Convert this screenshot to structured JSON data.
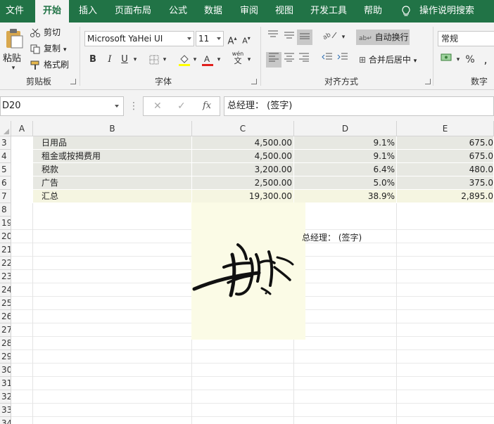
{
  "menu": {
    "tabs": [
      "文件",
      "开始",
      "插入",
      "页面布局",
      "公式",
      "数据",
      "审阅",
      "视图",
      "开发工具",
      "帮助"
    ],
    "tell_me": "操作说明搜索"
  },
  "ribbon": {
    "clipboard": {
      "paste": "粘贴",
      "cut": "剪切",
      "copy": "复制",
      "format_painter": "格式刷",
      "group": "剪贴板"
    },
    "font": {
      "name": "Microsoft YaHei UI",
      "size": "11",
      "bold": "B",
      "italic": "I",
      "underline": "U",
      "grow": "A",
      "shrink": "A",
      "phonetic_top": "wén",
      "phonetic_bottom": "文",
      "group": "字体"
    },
    "alignment": {
      "wrap_text": "自动换行",
      "merge_center": "合并后居中",
      "group": "对齐方式"
    },
    "number": {
      "format": "常规",
      "percent": "%",
      "comma": ",",
      "group": "数字"
    }
  },
  "formula_bar": {
    "name_box": "D20",
    "fx": "fx",
    "content": "总经理：  (签字)"
  },
  "grid": {
    "columns": [
      "A",
      "B",
      "C",
      "D",
      "E"
    ],
    "row_numbers": [
      "3",
      "4",
      "5",
      "6",
      "7",
      "8",
      "19",
      "20",
      "21",
      "22",
      "23",
      "24",
      "25",
      "26",
      "27",
      "28",
      "29",
      "30",
      "31",
      "32",
      "33",
      "34"
    ],
    "rows": [
      {
        "b": "日用品",
        "c": "4,500.00",
        "d": "9.1%",
        "e": "675.0"
      },
      {
        "b": "租金或按揭费用",
        "c": "4,500.00",
        "d": "9.1%",
        "e": "675.0"
      },
      {
        "b": "税款",
        "c": "3,200.00",
        "d": "6.4%",
        "e": "480.0"
      },
      {
        "b": "广告",
        "c": "2,500.00",
        "d": "5.0%",
        "e": "375.0"
      },
      {
        "b": "汇总",
        "c": "19,300.00",
        "d": "38.9%",
        "e": "2,895.0"
      }
    ],
    "manager_sign": "总经理：  (签字)"
  },
  "colors": {
    "accent": "#217346",
    "data_row": "#e7e8e2",
    "total_row": "#f5f5e1",
    "signature_bg": "#fbfbe6"
  }
}
